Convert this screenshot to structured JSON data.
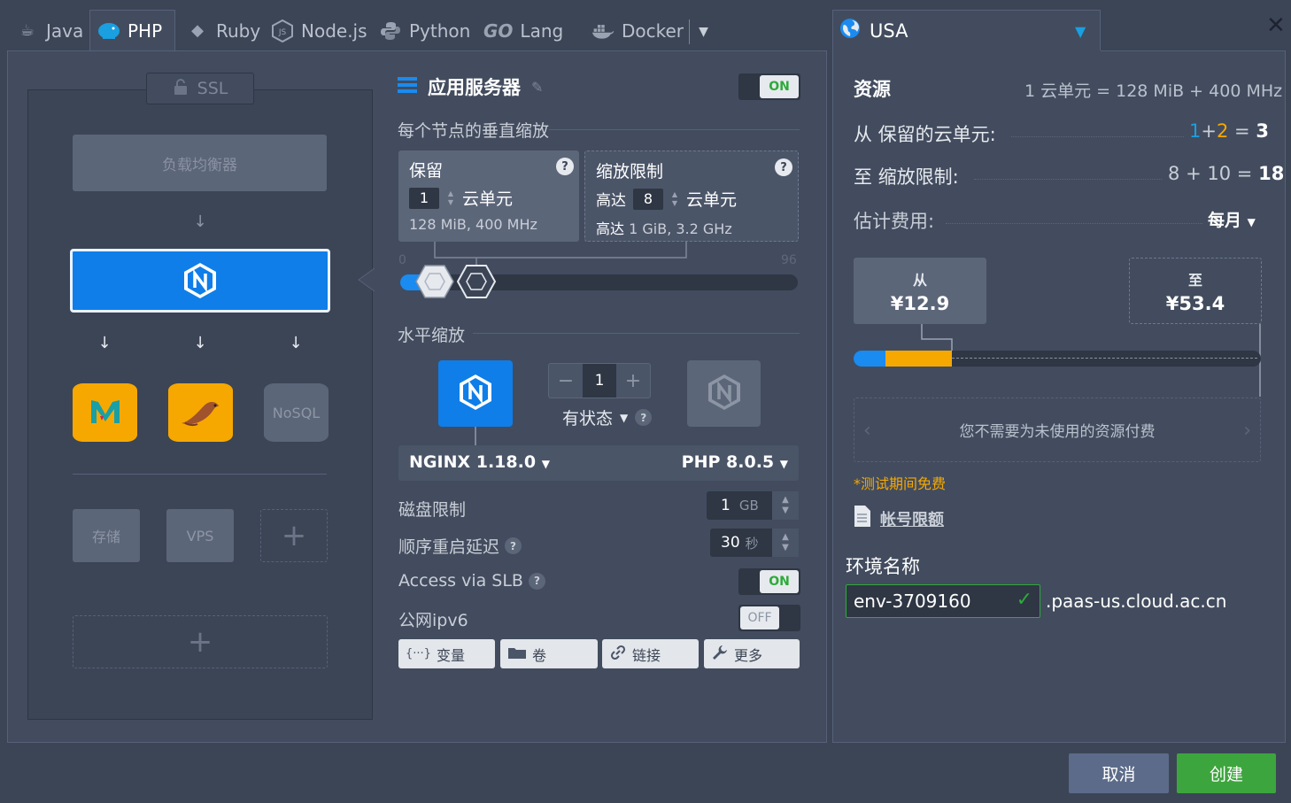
{
  "tabs": [
    {
      "label": "Java",
      "icon": "java-icon"
    },
    {
      "label": "PHP",
      "icon": "php-icon",
      "active": true
    },
    {
      "label": "Ruby",
      "icon": "ruby-icon"
    },
    {
      "label": "Node.js",
      "icon": "nodejs-icon"
    },
    {
      "label": "Python",
      "icon": "python-icon"
    },
    {
      "label": "Lang",
      "icon": "go-icon",
      "prefix": "GO"
    },
    {
      "label": "Docker",
      "icon": "docker-icon"
    }
  ],
  "region": {
    "label": "USA"
  },
  "topology": {
    "ssl": "SSL",
    "load_balancer": "负载均衡器",
    "nosql": "NoSQL",
    "storage": "存储",
    "vps": "VPS",
    "add": "+"
  },
  "app_server": {
    "title": "应用服务器",
    "toggle": "ON",
    "vertical_scaling": "每个节点的垂直缩放",
    "reserved": {
      "title": "保留",
      "value": "1",
      "unit": "云单元",
      "sub": "128 MiB, 400 MHz"
    },
    "limit": {
      "title": "缩放限制",
      "prefix": "高达",
      "value": "8",
      "unit": "云单元",
      "sub_prefix": "高达",
      "sub": "1 GiB, 3.2 GHz"
    },
    "slider": {
      "min": "0",
      "max": "96",
      "reserved": 1,
      "limit": 8
    },
    "horizontal_scaling": "水平缩放",
    "node_count": "1",
    "stateful": "有状态",
    "nginx_version": "NGINX 1.18.0",
    "php_version": "PHP 8.0.5",
    "disk_limit": {
      "label": "磁盘限制",
      "value": "1",
      "unit": "GB"
    },
    "restart_delay": {
      "label": "顺序重启延迟",
      "value": "30",
      "unit": "秒"
    },
    "slb": {
      "label": "Access via SLB",
      "toggle": "ON"
    },
    "ipv6": {
      "label": "公网ipv6",
      "toggle": "OFF"
    },
    "buttons": {
      "vars": "变量",
      "volumes": "卷",
      "links": "链接",
      "more": "更多"
    },
    "vars_icon_text": "{···}"
  },
  "resources": {
    "title": "资源",
    "formula": "1 云单元 = 128 MiB + 400 MHz",
    "reserved_label": "从 保留的云单元:",
    "reserved_a": "1",
    "reserved_b": "2",
    "reserved_total": "3",
    "limit_label": "至 缩放限制:",
    "limit_a": "8",
    "limit_b": "10",
    "limit_total": "18",
    "plus": "+",
    "equals": "=",
    "cost_label": "估计费用:",
    "period": "每月",
    "from_label": "从",
    "from_price": "¥12.9",
    "to_label": "至",
    "to_price": "¥53.4",
    "notice": "您不需要为未使用的资源付费",
    "trial": "*测试期间免费",
    "quota": "帐号限额"
  },
  "env": {
    "label": "环境名称",
    "name": "env-3709160",
    "domain": ".paas-us.cloud.ac.cn"
  },
  "footer": {
    "cancel": "取消",
    "create": "创建"
  },
  "colors": {
    "accent": "#0f7ee8",
    "success": "#3da53d",
    "warning": "#f6a800",
    "panel": "#424c5e"
  }
}
